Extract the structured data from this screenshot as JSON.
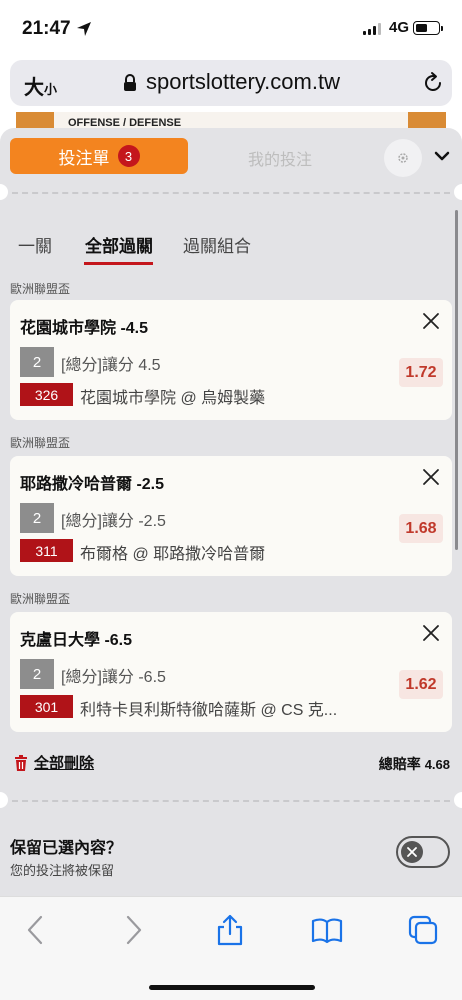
{
  "status_bar": {
    "time": "21:47",
    "network": "4G"
  },
  "address_bar": {
    "text_size_large": "大",
    "text_size_small": "小",
    "url": "sportslottery.com.tw"
  },
  "page": {
    "banner_text": "OFFENSE / DEFENSE"
  },
  "slip": {
    "tab_betslip_label": "投注單",
    "tab_betslip_count": "3",
    "tab_mybets_label": "我的投注",
    "mode_tabs": [
      "一關",
      "全部過關",
      "過關組合"
    ],
    "active_mode": "全部過關",
    "bets": [
      {
        "league": "歐洲聯盟盃",
        "title": "花園城市學院 -4.5",
        "period_type": "2",
        "market": "[總分]讓分 4.5",
        "code": "326",
        "match": "花園城市學院 @ 烏姆製藥",
        "odds": "1.72"
      },
      {
        "league": "歐洲聯盟盃",
        "title": "耶路撒冷哈普爾 -2.5",
        "period_type": "2",
        "market": "[總分]讓分 -2.5",
        "code": "311",
        "match": "布爾格 @ 耶路撒冷哈普爾",
        "odds": "1.68"
      },
      {
        "league": "歐洲聯盟盃",
        "title": "克盧日大學 -6.5",
        "period_type": "2",
        "market": "[總分]讓分 -6.5",
        "code": "301",
        "match": "利特卡貝利斯特徹哈薩斯 @ CS 克...",
        "odds": "1.62"
      }
    ],
    "delete_all_label": "全部刪除",
    "total_odds_label": "總賠率",
    "total_odds_value": "4.68",
    "retain_title": "保留已選內容？",
    "retain_subtitle": "您的投注將被保留"
  },
  "colors": {
    "accent_orange": "#f3841f",
    "brand_red": "#c4161c",
    "odds_red": "#c0392b"
  }
}
